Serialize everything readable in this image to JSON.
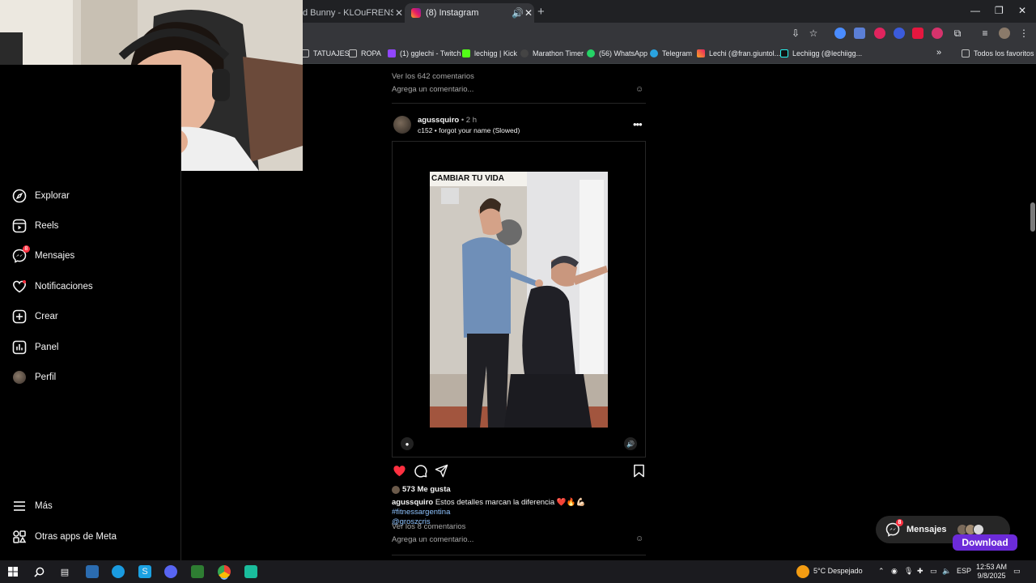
{
  "browser": {
    "tabs": [
      {
        "title": "d Bunny - KLOuFRENS (Vide",
        "active": false
      },
      {
        "title": "(8) Instagram",
        "active": true
      }
    ],
    "new_tab": "+",
    "window_controls": [
      "—",
      "❐",
      "✕"
    ],
    "bookmarks": [
      {
        "label": "TATUAJES",
        "icon": "folder-icon"
      },
      {
        "label": "ROPA",
        "icon": "folder-icon"
      },
      {
        "label": "(1) gglechi - Twitch",
        "icon": "twitch-icon"
      },
      {
        "label": "lechigg | Kick",
        "icon": "kick-icon"
      },
      {
        "label": "Marathon Timer",
        "icon": "timer-icon"
      },
      {
        "label": "(56) WhatsApp",
        "icon": "whatsapp-icon"
      },
      {
        "label": "Telegram",
        "icon": "telegram-icon"
      },
      {
        "label": "Lechi (@fran.giuntol...",
        "icon": "instagram-icon"
      },
      {
        "label": "Lechiigg (@lechiigg...",
        "icon": "tiktok-icon"
      }
    ],
    "bookmarks_more": "»",
    "all_bookmarks": "Todos los favoritos"
  },
  "sidebar": {
    "items": [
      {
        "label": "Explorar",
        "icon": "compass-icon"
      },
      {
        "label": "Reels",
        "icon": "reels-icon"
      },
      {
        "label": "Mensajes",
        "icon": "messenger-icon",
        "badge": "8"
      },
      {
        "label": "Notificaciones",
        "icon": "heart-icon"
      },
      {
        "label": "Crear",
        "icon": "plus-square-icon"
      },
      {
        "label": "Panel",
        "icon": "chart-icon"
      },
      {
        "label": "Perfil",
        "icon": "avatar-icon"
      }
    ],
    "more": "Más",
    "meta_apps": "Otras apps de Meta"
  },
  "prev_post": {
    "view_comments": "Ver los 642 comentarios",
    "add_comment": "Agrega un comentario..."
  },
  "post": {
    "username": "agussquiro",
    "time": "• 2 h",
    "audio": "c152 • forgot your name (Slowed)",
    "video_banner": "CAMBIAR TU VIDA",
    "likes": "573 Me gusta",
    "caption_user": "agussquiro",
    "caption_text": "Estos detalles marcan la diferencia ❤️🔥💪🏻",
    "hashtag": "#fitnessargentina",
    "mention": "@groszcris",
    "view_comments": "Ver los 8 comentarios",
    "add_comment": "Agrega un comentario...",
    "liked": true
  },
  "messages_pill": {
    "label": "Mensajes",
    "badge": "8",
    "download": "Download"
  },
  "taskbar": {
    "weather": "5°C Despejado",
    "lang": "ESP",
    "time": "12:53 AM",
    "date": "9/8/2025"
  },
  "colors": {
    "accent_like": "#ff3040",
    "link": "#8ec3ff",
    "download_button": "#6c2bd9"
  }
}
